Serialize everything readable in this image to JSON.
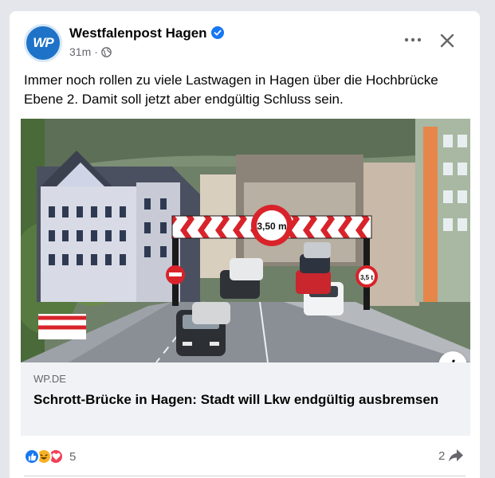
{
  "post": {
    "page_name": "Westfalenpost Hagen",
    "avatar_text": "WP",
    "time": "31m",
    "separator": "·",
    "text": "Immer noch rollen zu viele Lastwagen in Hagen über die Hochbrücke Ebene 2. Damit soll jetzt aber endgültig Schluss sein."
  },
  "image": {
    "height_sign": "3,50 m",
    "weight_sign": "3,5 t"
  },
  "link": {
    "domain": "WP.DE",
    "title": "Schrott-Brücke in Hagen: Stadt will Lkw endgültig ausbremsen"
  },
  "engagement": {
    "reaction_count": "5",
    "share_count": "2"
  },
  "colors": {
    "accent": "#1877f2",
    "link_bg": "#f0f2f5",
    "secondary_text": "#65676b"
  }
}
